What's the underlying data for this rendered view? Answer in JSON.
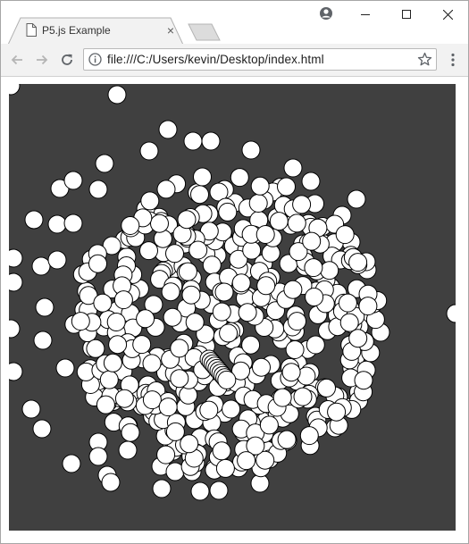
{
  "window": {
    "controls": {
      "minimize": "minimize",
      "maximize": "maximize",
      "close": "close"
    }
  },
  "tab": {
    "title": "P5.js Example",
    "close_glyph": "×",
    "icon": "document-icon"
  },
  "toolbar": {
    "url": "file:///C:/Users/kevin/Desktop/index.html",
    "icons": [
      "back-arrow-icon",
      "forward-arrow-icon",
      "reload-icon",
      "info-icon",
      "star-icon",
      "menu-icon",
      "profile-icon"
    ]
  },
  "sketch": {
    "background_color": "#404040",
    "circle_fill": "#ffffff",
    "circle_stroke": "#000000"
  }
}
